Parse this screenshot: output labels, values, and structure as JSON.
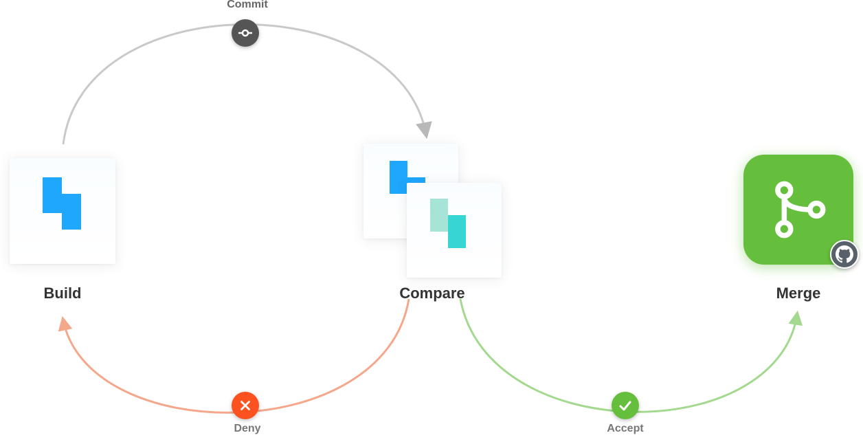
{
  "nodes": {
    "build": {
      "label": "Build"
    },
    "compare": {
      "label": "Compare"
    },
    "merge": {
      "label": "Merge"
    }
  },
  "edges": {
    "commit": {
      "label": "Commit",
      "icon": "commit-icon",
      "from": "build",
      "to": "compare",
      "color": "#B8B8B8"
    },
    "deny": {
      "label": "Deny",
      "icon": "close-icon",
      "from": "compare",
      "to": "build",
      "color": "#F5A78B"
    },
    "accept": {
      "label": "Accept",
      "icon": "check-icon",
      "from": "compare",
      "to": "merge",
      "color": "#A3D98F"
    }
  },
  "colors": {
    "blue": "#1EA7FD",
    "teal": "#37D5D3",
    "tealLt": "#A7E4D8",
    "green": "#66BF3C",
    "orange": "#FC521F",
    "gray": "#B8B8B8",
    "text": "#333333"
  }
}
